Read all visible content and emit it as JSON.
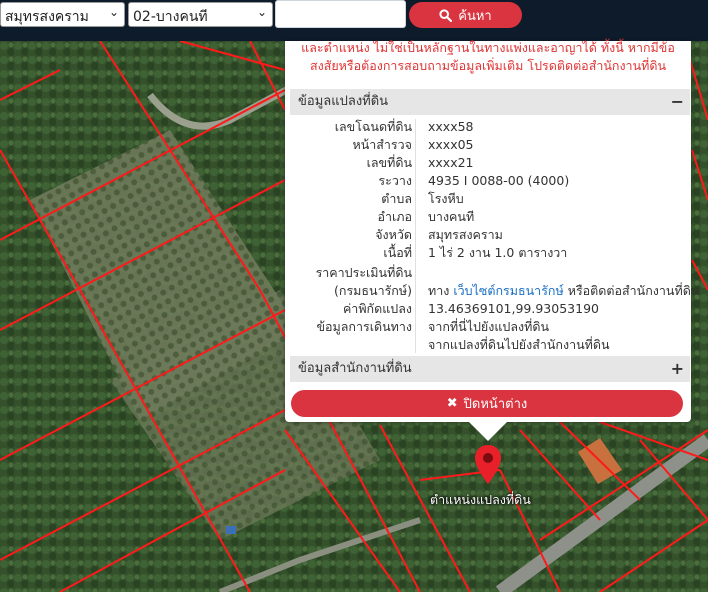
{
  "toolbar": {
    "province_value": "สมุทรสงคราม",
    "district_value": "02-บางคนที",
    "search_placeholder": "",
    "search_label": "ค้นหา"
  },
  "popup": {
    "notice": "และตำแหน่ง ไม่ใช่เป็นหลักฐานในทางแพ่งและอาญาได้ ทั้งนี้ หากมีข้อสงสัยหรือต้องการสอบถามข้อมูลเพิ่มเติม โปรดติดต่อสำนักงานที่ดิน",
    "parcel_section_title": "ข้อมูลแปลงที่ดิน",
    "parcel_toggle": "−",
    "office_section_title": "ข้อมูลสำนักงานที่ดิน",
    "office_toggle": "+",
    "close_label": "ปิดหน้าต่าง",
    "fields": {
      "deed_no": {
        "label": "เลขโฉนดที่ดิน",
        "value": "xxxx58"
      },
      "survey_page": {
        "label": "หน้าสำรวจ",
        "value": "xxxx05"
      },
      "land_no": {
        "label": "เลขที่ดิน",
        "value": "xxxx21"
      },
      "sheet": {
        "label": "ระวาง",
        "value": "4935 I 0088-00 (4000)"
      },
      "subdistrict": {
        "label": "ตำบล",
        "value": "โรงหีบ"
      },
      "district": {
        "label": "อำเภอ",
        "value": "บางคนที"
      },
      "province": {
        "label": "จังหวัด",
        "value": "สมุทรสงคราม"
      },
      "area": {
        "label": "เนื้อที่",
        "value": "1 ไร่ 2 งาน 1.0 ตารางวา"
      },
      "appraisal": {
        "label_1": "ราคาประเมินที่ดิน",
        "label_2": "(กรมธนารักษ์)",
        "value_pre": "ทาง",
        "value_link": "เว็บไซต์กรมธนารักษ์",
        "value_post": "หรือติดต่อสำนักงานที่ดิน"
      },
      "coordinates": {
        "label": "ค่าพิกัดแปลง",
        "value": "13.46369101,99.93053190"
      },
      "directions": {
        "label": "ข้อมูลการเดินทาง",
        "link_1": "จากที่นี่ไปยังแปลงที่ดิน",
        "link_2": "จากแปลงที่ดินไปยังสำนักงานที่ดิน"
      }
    }
  },
  "map": {
    "marker_label": "ตำแหน่งแปลงที่ดิน",
    "marker_color": "#e8202a",
    "parcel_line_color": "#ff1a1a"
  }
}
